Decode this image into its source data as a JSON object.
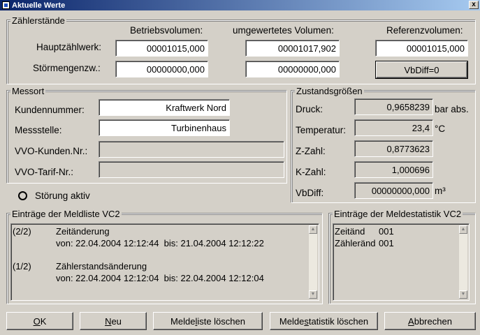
{
  "window": {
    "title": "Aktuelle Werte",
    "close_glyph": "x"
  },
  "zaehler": {
    "group_label": "Zählerstände",
    "col_betrieb": "Betriebsvolumen:",
    "col_umgewertet": "umgewertetes Volumen:",
    "col_referenz": "Referenzvolumen:",
    "row1_label": "Hauptzählwerk:",
    "row2_label": "Störmengenzw.:",
    "haupt_betrieb": "00001015,000",
    "haupt_umgewertet": "00001017,902",
    "haupt_referenz": "00001015,000",
    "stoer_betrieb": "00000000,000",
    "stoer_umgewertet": "00000000,000",
    "vbdiff_button": "VbDiff=0"
  },
  "messort": {
    "group_label": "Messort",
    "kunden_label": "Kundennummer:",
    "kunden_value": "Kraftwerk Nord",
    "mess_label": "Messstelle:",
    "mess_value": "Turbinenhaus",
    "vvo_kunden_label": "VVO-Kunden.Nr.:",
    "vvo_kunden_value": "",
    "vvo_tarif_label": "VVO-Tarif-Nr.:",
    "vvo_tarif_value": ""
  },
  "stoerung": {
    "label": "Störung aktiv"
  },
  "zustand": {
    "group_label": "Zustandsgrößen",
    "druck_label": "Druck:",
    "druck_value": "0,9658239",
    "druck_unit": "bar abs.",
    "temp_label": "Temperatur:",
    "temp_value": "23,4",
    "temp_unit": "°C",
    "z_label": "Z-Zahl:",
    "z_value": "0,8773623",
    "k_label": "K-Zahl:",
    "k_value": "1,000696",
    "vbdiff_label": "VbDiff:",
    "vbdiff_value": "00000000,000",
    "vbdiff_unit": "m³"
  },
  "meldeliste": {
    "group_label": "Einträge der Meldliste VC2",
    "entries": [
      {
        "idx": "(2/2)",
        "title": "Zeitänderung",
        "detail": "von: 22.04.2004 12:12:44  bis: 21.04.2004 12:12:22"
      },
      {
        "idx": "(1/2)",
        "title": "Zählerstandsänderung",
        "detail": "von: 22.04.2004 12:12:04  bis: 22.04.2004 12:12:04"
      }
    ]
  },
  "meldestatistik": {
    "group_label": "Einträge der Meldestatistik VC2",
    "rows": [
      {
        "name": "Zeitänd",
        "count": "001"
      },
      {
        "name": "Zähleränd",
        "count": "001"
      }
    ]
  },
  "buttons": {
    "ok_u": "O",
    "ok_rest": "K",
    "neu_u": "N",
    "neu_rest": "eu",
    "meldeliste_pre": "Melde",
    "meldeliste_u": "l",
    "meldeliste_rest": "iste löschen",
    "meldestat_pre": "Melde",
    "meldestat_u": "s",
    "meldestat_rest": "tatistik löschen",
    "abbrechen_u": "A",
    "abbrechen_rest": "bbrechen"
  }
}
